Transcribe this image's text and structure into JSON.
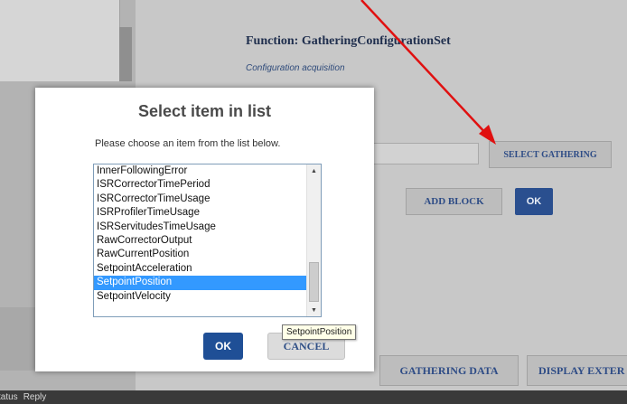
{
  "function": {
    "title": "Function: GatheringConfigurationSet",
    "subtitle": "Configuration acquisition"
  },
  "buttons": {
    "select_gathering": "SELECT GATHERING",
    "add_block": "ADD BLOCK",
    "ok": "OK",
    "gathering_data": "GATHERING DATA",
    "display": "DISPLAY EXTER"
  },
  "status_bar": {
    "status": "tatus",
    "reply": "Reply"
  },
  "dialog": {
    "title": "Select item in list",
    "prompt": "Please choose an item from the list below.",
    "items": [
      "InnerFollowingError",
      "ISRCorrectorTimePeriod",
      "ISRCorrectorTimeUsage",
      "ISRProfilerTimeUsage",
      "ISRServitudesTimeUsage",
      "RawCorrectorOutput",
      "RawCurrentPosition",
      "SetpointAcceleration",
      "SetpointPosition",
      "SetpointVelocity"
    ],
    "selected_index": 8,
    "tooltip": "SetpointPosition",
    "ok_label": "OK",
    "cancel_label": "CANCEL"
  },
  "colors": {
    "selection": "#3399ff",
    "primary_button": "#1f4f96",
    "annotation_arrow": "#e01010"
  },
  "icons": {
    "scroll_up": "scroll-up-icon",
    "scroll_down": "scroll-down-icon",
    "annotation": "red-arrow-icon"
  }
}
